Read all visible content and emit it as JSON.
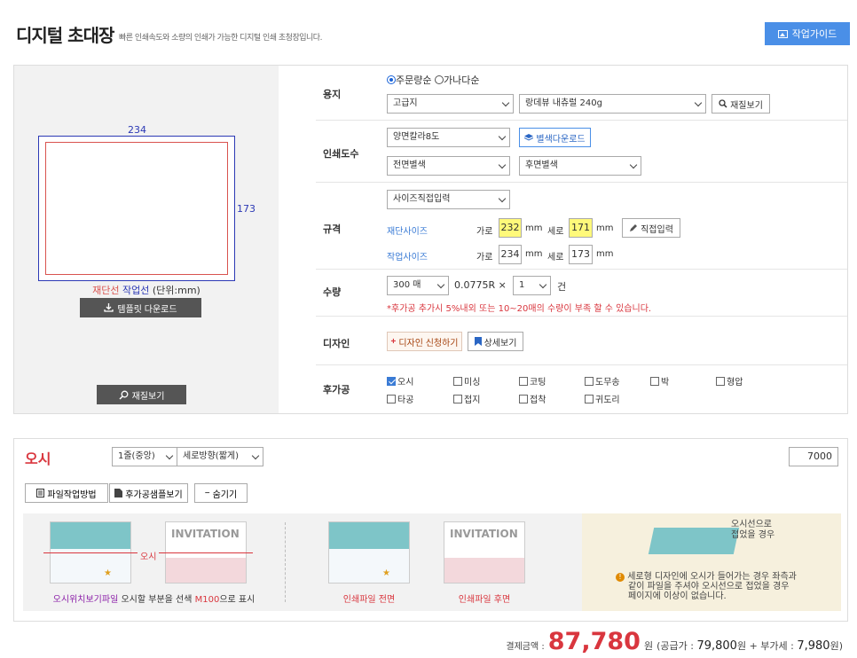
{
  "header": {
    "title": "디지털 초대장",
    "subtitle": "빠른 인쇄속도와 소량의 인쇄가 가능한 디지털 인쇄 초청장입니다.",
    "guide_button": "작업가이드"
  },
  "preview": {
    "width_label": "234",
    "height_label": "173",
    "legend_cut": "재단선",
    "legend_work": "작업선",
    "legend_unit": "(단위:mm)",
    "template_button": "템플릿 다운로드",
    "paper_button": "재질보기"
  },
  "paper": {
    "label": "용지",
    "sort_order": "주문량순",
    "sort_alpha": "가나다순",
    "type_value": "고급지",
    "stock_value": "랑데뷰 내츄럴 240g",
    "view_button": "재질보기"
  },
  "colors": {
    "label": "인쇄도수",
    "print_value": "양면칼라8도",
    "download_button": "별색다운로드",
    "front_value": "전면별색",
    "back_value": "후면별색"
  },
  "size": {
    "label": "규격",
    "mode_value": "사이즈직접입력",
    "cut_label": "재단사이즈",
    "work_label": "작업사이즈",
    "w_label": "가로",
    "h_label": "세로",
    "unit": "mm",
    "cut_w": "232",
    "cut_h": "171",
    "work_w": "234",
    "work_h": "173",
    "direct_button": "직접입력"
  },
  "quantity": {
    "label": "수량",
    "qty_value": "300 매",
    "rate": "0.0775R ×",
    "count_value": "1",
    "unit": "건",
    "warning": "*후가공 추가시 5%내외 또는 10~20매의 수량이 부족 할 수 있습니다."
  },
  "design": {
    "label": "디자인",
    "apply_button": "디자인 신청하기",
    "detail_button": "상세보기"
  },
  "finishing": {
    "label": "후가공",
    "items": [
      {
        "name": "오시",
        "checked": true
      },
      {
        "name": "미싱",
        "checked": false
      },
      {
        "name": "코팅",
        "checked": false
      },
      {
        "name": "도무송",
        "checked": false
      },
      {
        "name": "박",
        "checked": false
      },
      {
        "name": "형압",
        "checked": false
      },
      {
        "name": "타공",
        "checked": false
      },
      {
        "name": "접지",
        "checked": false
      },
      {
        "name": "접착",
        "checked": false
      },
      {
        "name": "귀도리",
        "checked": false
      }
    ]
  },
  "osi": {
    "title": "오시",
    "line_value": "1줄(중앙)",
    "direction_value": "세로방향(짧게)",
    "price_value": "7000",
    "method_button": "파일작업방법",
    "sample_button": "후가공샘플보기",
    "hide_button": "숨기기",
    "thumb_label": "오시",
    "caption_left_a": "오시위치보기파일",
    "caption_left_b": "오시할 부분을 선색",
    "caption_left_c": "M100",
    "caption_left_d": "으로 표시",
    "caption_front": "인쇄파일 전면",
    "caption_back": "인쇄파일 후면",
    "fold_note_1": "오시선으로",
    "fold_note_2": "접었을 경우",
    "info_text_1": "세로형 디자인에 오시가 들어가는 경우 좌측과",
    "info_text_2": "같이 파일을 주셔야 오시선으로 접었을 경우",
    "info_text_3": "페이지에 이상이 없습니다.",
    "invitation_text": "INVITATION"
  },
  "total": {
    "label": "결제금액 :",
    "amount": "87,780",
    "won": "원",
    "supply_label": "(공급가 :",
    "supply_value": "79,800",
    "tax_label": "원 + 부가세 :",
    "tax_value": "7,980",
    "end": "원)"
  }
}
